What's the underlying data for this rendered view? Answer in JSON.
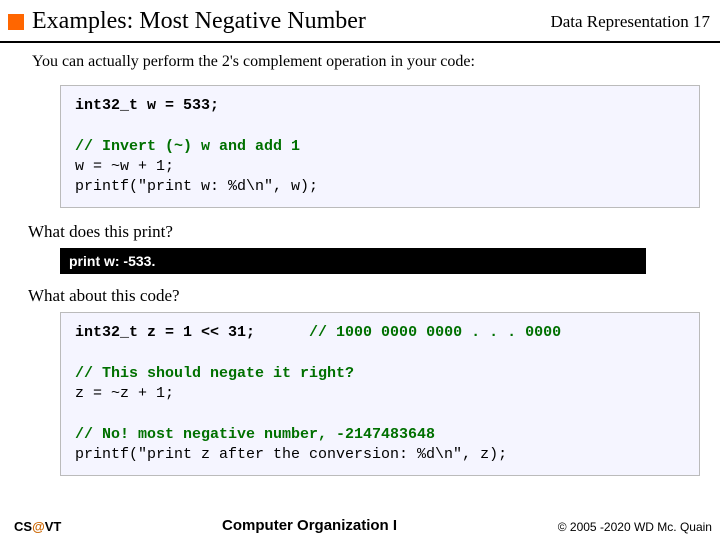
{
  "header": {
    "title": "Examples: Most Negative Number",
    "topic": "Data Representation",
    "page": "17"
  },
  "intro": "You can actually perform the 2's complement operation in your code:",
  "code1": {
    "l1": "int32_t w = 533;",
    "blank1": "",
    "c1": "// Invert (~) w and add 1",
    "l2": "w = ~w + 1;",
    "l3": "printf(\"print w: %d\\n\", w);"
  },
  "q1": "What does this print?",
  "output1": "print w: -533.",
  "q2": "What about this code?",
  "code2": {
    "l1a": "int32_t z = 1 << 31;",
    "l1b": "// 1000 0000 0000 . . . 0000",
    "blank1": "",
    "c1": "// This should negate it right?",
    "l2": "z = ~z + 1;",
    "blank2": "",
    "c2": "// No! most negative number, -2147483648",
    "l3": "printf(\"print z after the conversion: %d\\n\", z);"
  },
  "footer": {
    "left_a": "CS",
    "left_at": "@",
    "left_b": "VT",
    "mid": "Computer Organization I",
    "right": "© 2005 -2020 WD Mc. Quain"
  }
}
